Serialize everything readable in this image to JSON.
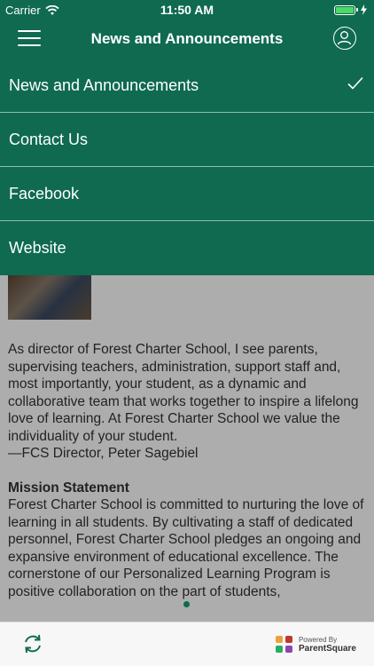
{
  "status_bar": {
    "carrier": "Carrier",
    "time": "11:50 AM"
  },
  "nav": {
    "title": "News and Announcements"
  },
  "menu": {
    "items": [
      {
        "label": "News and Announcements",
        "selected": true
      },
      {
        "label": "Contact Us",
        "selected": false
      },
      {
        "label": "Facebook",
        "selected": false
      },
      {
        "label": "Website",
        "selected": false
      }
    ]
  },
  "content": {
    "paragraph": "As director of Forest Charter School, I see parents, supervising teachers, administration, support staff and, most importantly, your student, as a dynamic and collaborative team that works together to inspire a lifelong love of learning. At Forest Charter School we value the individuality of your student.",
    "signature": "—FCS Director, Peter Sagebiel",
    "mission_title": "Mission Statement",
    "mission_text": "Forest Charter School is committed to nurturing the love of learning in all students. By cultivating a staff of dedicated personnel, Forest Charter School pledges an ongoing and expansive environment of educational excellence. The cornerstone of our Personalized Learning Program is positive collaboration on the part of students,"
  },
  "footer": {
    "powered_by": "Powered By",
    "brand": "ParentSquare"
  },
  "colors": {
    "brand_green": "#0f6a50",
    "battery_green": "#4cd964"
  }
}
